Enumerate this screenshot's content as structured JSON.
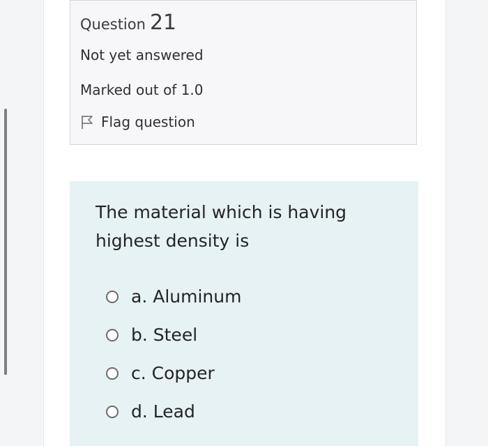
{
  "question_info": {
    "label": "Question",
    "number": "21",
    "status": "Not yet answered",
    "marks": "Marked out of 1.0",
    "flag_label": "Flag question"
  },
  "question": {
    "text": "The material which is having highest density is",
    "answers": [
      {
        "label": "a. Aluminum",
        "selected": false
      },
      {
        "label": "b. Steel",
        "selected": false
      },
      {
        "label": "c. Copper",
        "selected": false
      },
      {
        "label": "d. Lead",
        "selected": false
      }
    ]
  },
  "colors": {
    "info_background": "#f7f7f9",
    "question_background": "#e7f2f4",
    "page_background": "#f4f5f7"
  }
}
